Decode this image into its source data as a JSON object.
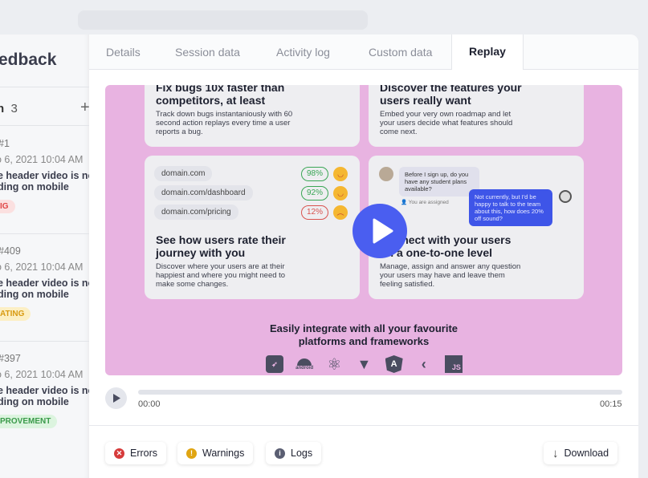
{
  "sidebar": {
    "title": "edback",
    "count_label": "n",
    "count": "3",
    "add_icon": "plus-icon",
    "items": [
      {
        "number": "#1",
        "date": "o 6, 2021 10:04 AM",
        "title1": "e header video is no",
        "title2": "ding on mobile",
        "badge": "IG",
        "badge_color": "#e04545",
        "badge_bg": "#fbe0e0"
      },
      {
        "number": "#409",
        "date": "o 6, 2021 10:04 AM",
        "title1": "e header video is no",
        "title2": "ding on mobile",
        "badge": "ATING",
        "badge_color": "#d89a12",
        "badge_bg": "#fcefc4"
      },
      {
        "number": "#397",
        "date": "o 6, 2021 10:04 AM",
        "title1": "e header video is no",
        "title2": "ding on mobile",
        "badge": "PROVEMENT",
        "badge_color": "#3a9a4a",
        "badge_bg": "#dcf4df"
      }
    ]
  },
  "tabs": [
    "Details",
    "Session data",
    "Activity log",
    "Custom data",
    "Replay"
  ],
  "active_tab": "Replay",
  "video": {
    "card1": {
      "title1": "Fix bugs 10x faster than",
      "title2": "competitors, at least",
      "body": [
        "Track down bugs instantaniously with 60",
        "second action replays every time a user",
        "reports a bug."
      ]
    },
    "card2": {
      "title1": "Discover the features your",
      "title2": "users really want",
      "body": [
        "Embed your very own roadmap and let",
        "your users decide what features should",
        "come next."
      ]
    },
    "card3": {
      "domains": [
        {
          "url": "domain.com",
          "pct": "98%",
          "color": "#3aa655"
        },
        {
          "url": "domain.com/dashboard",
          "pct": "92%",
          "color": "#3aa655"
        },
        {
          "url": "domain.com/pricing",
          "pct": "12%",
          "color": "#d9534f"
        }
      ],
      "title1": "See how users rate their",
      "title2": "journey with you",
      "body": [
        "Discover where your users are at their",
        "happiest and where you might need to",
        "make some changes."
      ]
    },
    "card4": {
      "question": "Before I sign up, do you have any student plans available?",
      "assigned": "You are assigned",
      "answer": "Not currently, but I'd be happy to talk to the team about this, how does 20% off sound?",
      "title1": "Connect with your users",
      "title2": "on a one-to-one level",
      "body": [
        "Manage, assign and answer any question",
        "your users may have and leave them",
        "feeling satisfied."
      ]
    },
    "integrate1": "Easily integrate with all your favourite",
    "integrate2": "platforms and frameworks",
    "logos": [
      "swift",
      "android",
      "react",
      "vue",
      "angular",
      "flutter",
      "JS"
    ],
    "android_label": "android",
    "js_label": "JS",
    "background": "#e8b3e1",
    "play_color": "#4a5ef0"
  },
  "player": {
    "current": "00:00",
    "duration": "00:15",
    "progress": 0
  },
  "actions": {
    "errors": "Errors",
    "warnings": "Warnings",
    "logs": "Logs",
    "download": "Download"
  }
}
